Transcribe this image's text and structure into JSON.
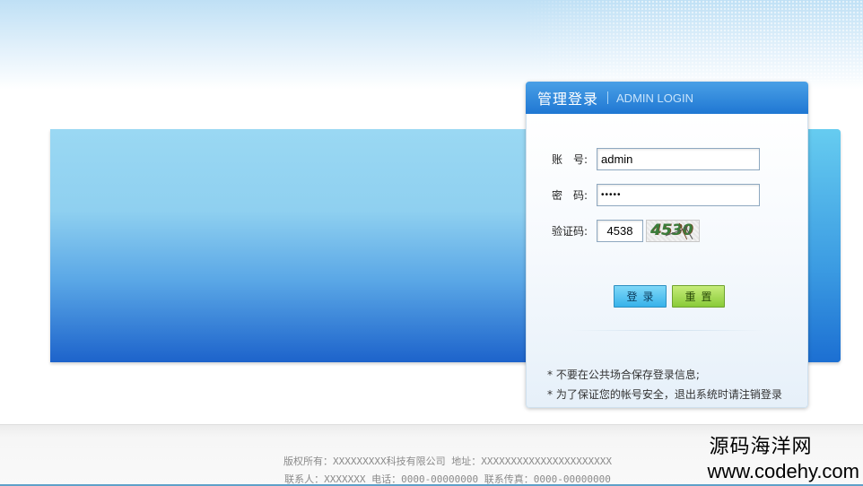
{
  "login": {
    "title": "管理登录",
    "subtitle": "ADMIN LOGIN",
    "username_label": "账　号:",
    "username_value": "admin",
    "password_label": "密　码:",
    "password_value": "•••••",
    "captcha_label": "验证码:",
    "captcha_value": "4538",
    "captcha_image_text": "4530",
    "login_button": "登录",
    "reset_button": "重置"
  },
  "tips": [
    "* 不要在公共场合保存登录信息;",
    "* 为了保证您的帐号安全，退出系统时请注销登录"
  ],
  "footer": {
    "line1": "版权所有：XXXXXXXXX科技有限公司 地址：XXXXXXXXXXXXXXXXXXXXXX",
    "line2": "联系人：XXXXXXX 电话：0000-00000000 联系传真：0000-00000000"
  },
  "watermark": {
    "cn": "源码海洋网",
    "url": "www.codehy.com"
  },
  "colors": {
    "header_blue": "#1f77d3",
    "banner_top": "#9ad8f3",
    "banner_bottom": "#1d63cb",
    "login_button": "#37b2ea",
    "reset_button": "#89cb38"
  }
}
